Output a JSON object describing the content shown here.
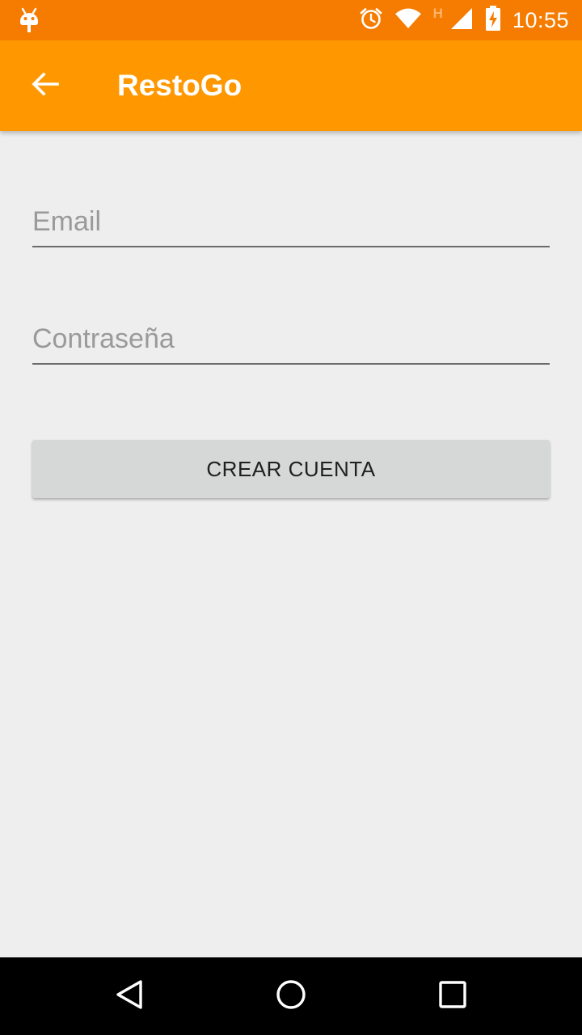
{
  "status_bar": {
    "time": "10:55",
    "network_type": "H",
    "icons": [
      "android-icon",
      "alarm-icon",
      "wifi-icon",
      "cell-signal-icon",
      "battery-charging-icon"
    ]
  },
  "app_bar": {
    "title": "RestoGo",
    "back_icon": "arrow-back-icon",
    "background": "#ff9800"
  },
  "form": {
    "email": {
      "value": "",
      "placeholder": "Email"
    },
    "password": {
      "value": "",
      "placeholder": "Contraseña"
    },
    "submit_label": "CREAR CUENTA"
  },
  "nav_bar": {
    "icons": [
      "nav-back-icon",
      "nav-home-icon",
      "nav-recents-icon"
    ]
  },
  "colors": {
    "status_bar": "#f57c00",
    "app_bar": "#ff9800",
    "background": "#eeeeee",
    "button": "#d6d7d7"
  }
}
